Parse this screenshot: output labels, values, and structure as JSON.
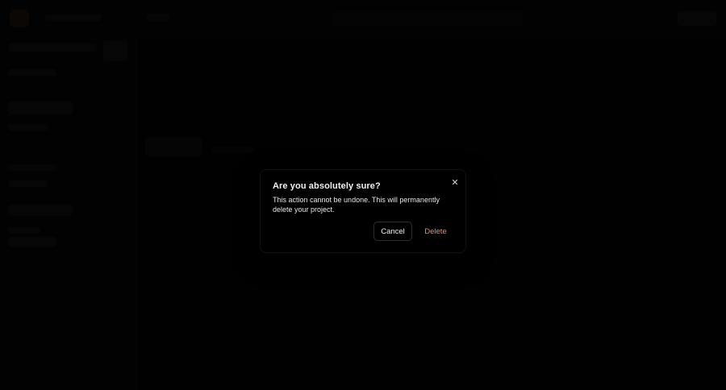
{
  "dialog": {
    "title": "Are you absolutely sure?",
    "description": "This action cannot be undone. This will permanently delete your project.",
    "cancel_label": "Cancel",
    "delete_label": "Delete",
    "close_icon": "close-icon"
  },
  "colors": {
    "background": "#030303",
    "dialog_bg": "#000000",
    "delete_text": "#f08a6c",
    "text": "#f2f2f2"
  }
}
